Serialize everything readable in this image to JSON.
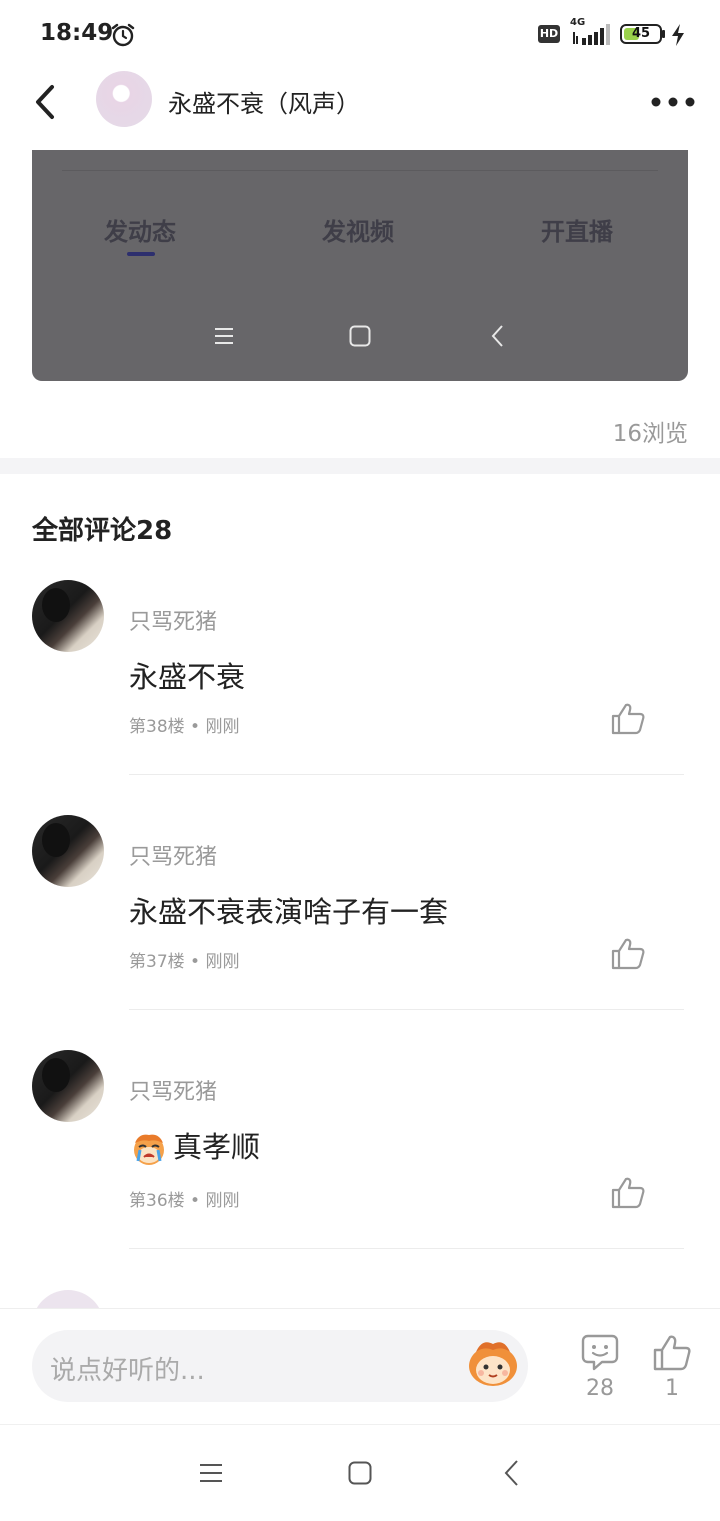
{
  "status_bar": {
    "time": "18:49",
    "hd": "HD",
    "network": "4G",
    "battery": "45",
    "battery_level": 0.45
  },
  "header": {
    "title": "永盛不衰（风声）"
  },
  "card": {
    "tabs": [
      "发动态",
      "发视频",
      "开直播"
    ],
    "active_tab": 0
  },
  "views": "16浏览",
  "comments": {
    "title": "全部评论28",
    "items": [
      {
        "user": "只骂死猪",
        "text": "永盛不衰",
        "meta": "第38楼 • 刚刚"
      },
      {
        "user": "只骂死猪",
        "text": "永盛不衰表演啥子有一套",
        "meta": "第37楼 • 刚刚"
      },
      {
        "user": "只骂死猪",
        "text": "真孝顺",
        "meta": "第36楼 • 刚刚",
        "emoji": "crying-face"
      }
    ]
  },
  "bottom_bar": {
    "placeholder": "说点好听的...",
    "comment_count": "28",
    "like_count": "1"
  },
  "colors": {
    "card_bg": "#676669",
    "active_tab_underline": "#2d2f6e",
    "battery_fill": "#9ad24b"
  }
}
